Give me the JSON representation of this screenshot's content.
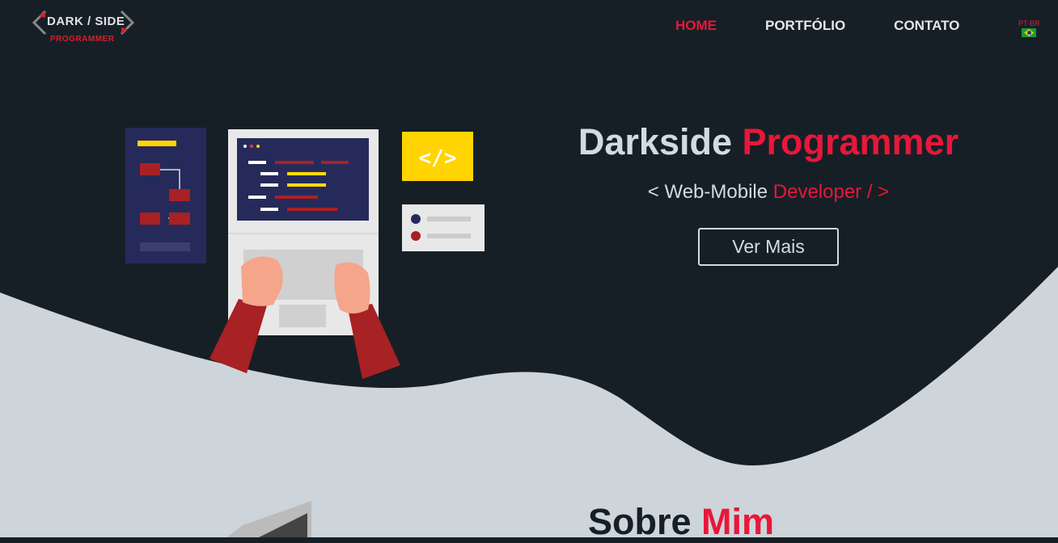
{
  "logo": {
    "main": "DARK / SIDE",
    "sub": "PROGRAMMER"
  },
  "nav": {
    "items": [
      {
        "label": "HOME",
        "active": true
      },
      {
        "label": "PORTFÓLIO"
      },
      {
        "label": "CONTATO"
      }
    ],
    "lang": "PT-BR",
    "lang_icon": "brazil-flag-icon"
  },
  "hero": {
    "title_a": "Darkside",
    "title_b": "Programmer",
    "subtitle_a": "< Web-Mobile",
    "subtitle_b": "Developer / >",
    "button": "Ver Mais"
  },
  "about": {
    "title_a": "Sobre",
    "title_b": "Mim"
  },
  "colors": {
    "dark": "#171f26",
    "light": "#cdd5da",
    "accent": "#e8173a"
  }
}
